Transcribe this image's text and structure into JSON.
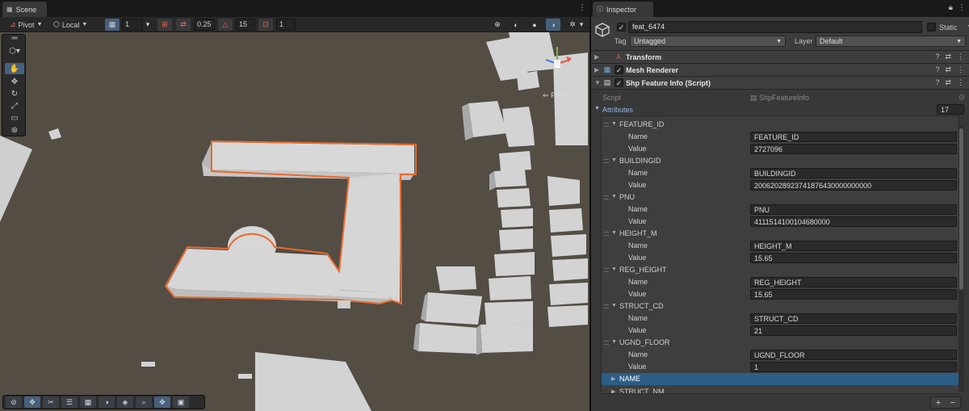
{
  "scene": {
    "tab_title": "Scene",
    "toolbar": {
      "pivot_label": "Pivot",
      "space_label": "Local",
      "grid_value": "1",
      "snap_value": "0.25",
      "rotate_snap": "15",
      "scale_snap": "1"
    },
    "persp_label": "Persp"
  },
  "inspector": {
    "tab_title": "Inspector",
    "object_name": "feat_6474",
    "static_label": "Static",
    "tag_label": "Tag",
    "tag_value": "Untagged",
    "layer_label": "Layer",
    "layer_value": "Default",
    "components": [
      {
        "title": "Transform"
      },
      {
        "title": "Mesh Renderer"
      },
      {
        "title": "Shp Feature Info (Script)"
      }
    ],
    "script_label": "Script",
    "script_value": "ShpFeatureInfo",
    "attributes_label": "Attributes",
    "attributes_count": "17",
    "name_label": "Name",
    "value_label": "Value",
    "elements": [
      {
        "title": "FEATURE_ID",
        "name": "FEATURE_ID",
        "value": "2727096"
      },
      {
        "title": "BUILDINGID",
        "name": "BUILDINGID",
        "value": "20062028923741876430000000000"
      },
      {
        "title": "PNU",
        "name": "PNU",
        "value": "4111514100104680000"
      },
      {
        "title": "HEIGHT_M",
        "name": "HEIGHT_M",
        "value": "15.65"
      },
      {
        "title": "REG_HEIGHT",
        "name": "REG_HEIGHT",
        "value": "15.65"
      },
      {
        "title": "STRUCT_CD",
        "name": "STRUCT_CD",
        "value": "21"
      },
      {
        "title": "UGND_FLOOR",
        "name": "UGND_FLOOR",
        "value": "1"
      }
    ],
    "collapsed_elements": [
      "NAME",
      "STRUCT_NM"
    ],
    "footer_add": "+",
    "footer_remove": "−"
  }
}
